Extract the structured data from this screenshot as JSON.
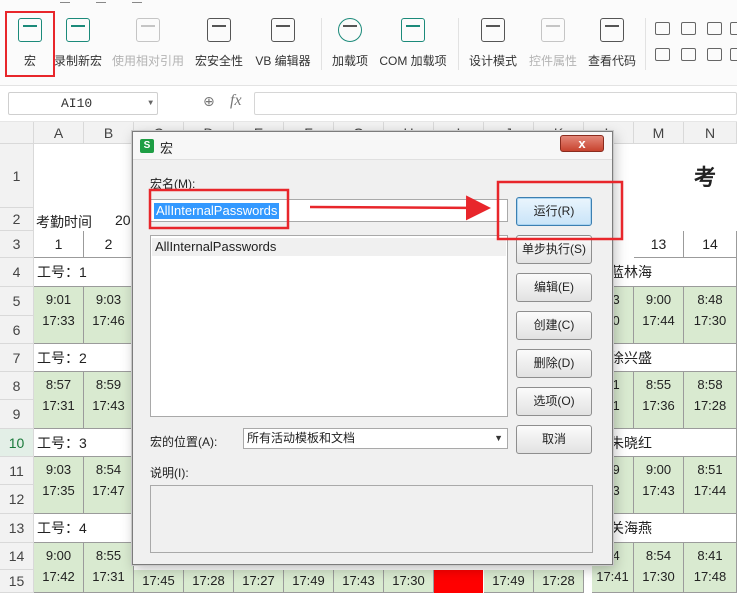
{
  "ribbon": {
    "buttons": [
      {
        "label": "宏",
        "icon": "macro-icon",
        "disabled": false
      },
      {
        "label": "录制新宏",
        "icon": "record-macro-icon",
        "disabled": false
      },
      {
        "label": "使用相对引用",
        "icon": "relative-reference-icon",
        "disabled": true
      },
      {
        "label": "宏安全性",
        "icon": "macro-security-icon",
        "disabled": false
      },
      {
        "label": "VB 编辑器",
        "icon": "vb-editor-icon",
        "disabled": false
      },
      {
        "label": "加载项",
        "icon": "addins-gear-icon",
        "disabled": false
      },
      {
        "label": "COM 加载项",
        "icon": "com-addins-icon",
        "disabled": false
      },
      {
        "label": "设计模式",
        "icon": "design-mode-icon",
        "disabled": false
      },
      {
        "label": "控件属性",
        "icon": "control-properties-icon",
        "disabled": true
      },
      {
        "label": "查看代码",
        "icon": "view-code-icon",
        "disabled": false
      }
    ]
  },
  "formula_bar": {
    "name_box": "AI10",
    "fx": "fx",
    "formula": ""
  },
  "sheet": {
    "columns": [
      "A",
      "B",
      "C",
      "D",
      "E",
      "F",
      "G",
      "H",
      "I",
      "J",
      "K",
      "L",
      "M",
      "N"
    ],
    "rows": [
      "1",
      "2",
      "3",
      "4",
      "5",
      "6",
      "7",
      "8",
      "9",
      "10",
      "11",
      "12",
      "13",
      "14",
      "15"
    ],
    "active_row": "10",
    "title_partial": "考",
    "attendance_label": "考勤时间",
    "attendance_value_partial": "20",
    "day_numbers": {
      "a": "1",
      "b": "2",
      "m": "13",
      "n": "14"
    },
    "employees": [
      {
        "id_label": "工号：1",
        "name_partial": "：蓝林海",
        "a": [
          "9:01",
          "17:33"
        ],
        "b": [
          "9:03",
          "17:46"
        ],
        "l": [
          "03",
          "30"
        ],
        "m": [
          "9:00",
          "17:44"
        ],
        "n": [
          "8:48",
          "17:30"
        ]
      },
      {
        "id_label": "工号：2",
        "name_partial": "：徐兴盛",
        "a": [
          "8:57",
          "17:31"
        ],
        "b": [
          "8:59",
          "17:43"
        ],
        "l": [
          "01",
          "31"
        ],
        "m": [
          "8:55",
          "17:36"
        ],
        "n": [
          "8:58",
          "17:28"
        ]
      },
      {
        "id_label": "工号：3",
        "name_partial": "：朱晓红",
        "a": [
          "9:03",
          "17:35"
        ],
        "b": [
          "8:54",
          "17:47"
        ],
        "l": [
          "49",
          "33"
        ],
        "m": [
          "9:00",
          "17:43"
        ],
        "n": [
          "8:51",
          "17:44"
        ]
      },
      {
        "id_label": "工号：4",
        "name_partial": "：关海燕",
        "a": [
          "9:00",
          "17:42"
        ],
        "b": [
          "8:55",
          "17:31"
        ],
        "l": [
          "54",
          "17:41"
        ],
        "m": [
          "8:54",
          "17:30"
        ],
        "n": [
          "8:41",
          "17:48"
        ]
      }
    ],
    "row15_extra": [
      "17:45",
      "17:28",
      "17:27",
      "17:49",
      "17:43",
      "17:30",
      "",
      "17:49",
      "17:28"
    ]
  },
  "dialog": {
    "title": "宏",
    "close_label": "x",
    "macro_name_label": "宏名(M):",
    "macro_name_value": "AllInternalPasswords",
    "macro_list": [
      "AllInternalPasswords"
    ],
    "buttons": {
      "run": "运行(R)",
      "step": "单步执行(S)",
      "edit": "编辑(E)",
      "create": "创建(C)",
      "delete": "删除(D)",
      "options": "选项(O)",
      "cancel": "取消"
    },
    "location_label": "宏的位置(A):",
    "location_value": "所有活动模板和文档",
    "description_label": "说明(I):",
    "description_value": ""
  },
  "colors": {
    "highlight": "#e8262b",
    "cell_green": "#d9ead0",
    "selection_blue": "#3399ff",
    "wps_green": "#1e9e44"
  }
}
